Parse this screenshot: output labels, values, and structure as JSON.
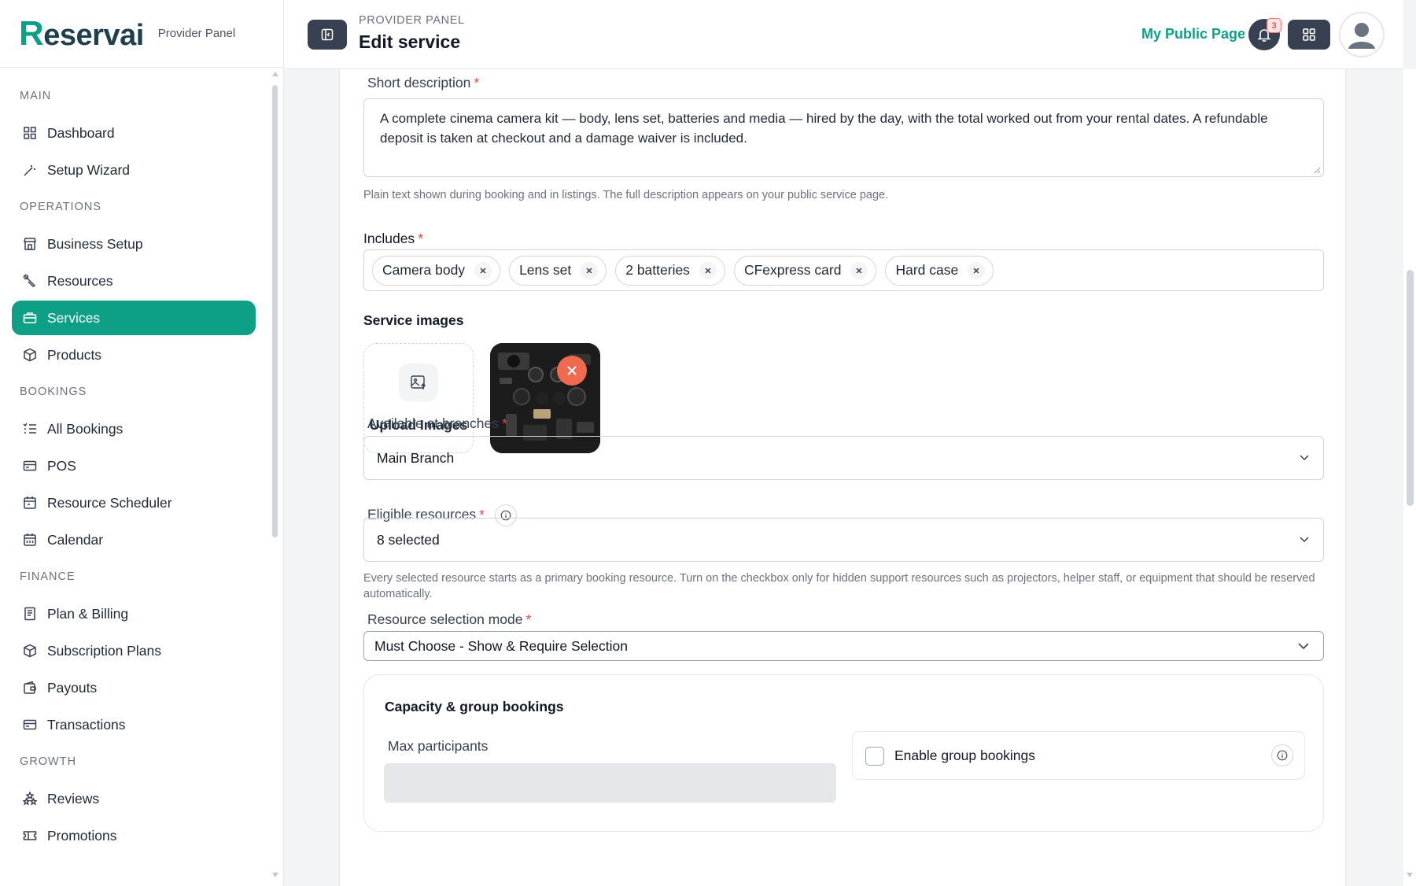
{
  "brand": {
    "logo_initial": "R",
    "logo_rest": "eservai",
    "subtitle": "Provider Panel"
  },
  "sidebar": {
    "sections": [
      {
        "title": "MAIN",
        "items": [
          {
            "label": "Dashboard",
            "icon": "grid-icon"
          },
          {
            "label": "Setup Wizard",
            "icon": "wand-icon"
          }
        ]
      },
      {
        "title": "OPERATIONS",
        "items": [
          {
            "label": "Business Setup",
            "icon": "store-icon"
          },
          {
            "label": "Resources",
            "icon": "tool-icon"
          },
          {
            "label": "Services",
            "icon": "briefcase-icon",
            "active": true
          },
          {
            "label": "Products",
            "icon": "box-icon"
          }
        ]
      },
      {
        "title": "BOOKINGS",
        "items": [
          {
            "label": "All Bookings",
            "icon": "list-icon"
          },
          {
            "label": "POS",
            "icon": "card-icon"
          },
          {
            "label": "Resource Scheduler",
            "icon": "calendar-icon"
          },
          {
            "label": "Calendar",
            "icon": "calendar-grid-icon"
          }
        ]
      },
      {
        "title": "FINANCE",
        "items": [
          {
            "label": "Plan & Billing",
            "icon": "receipt-icon"
          },
          {
            "label": "Subscription Plans",
            "icon": "box-icon"
          },
          {
            "label": "Payouts",
            "icon": "wallet-icon"
          },
          {
            "label": "Transactions",
            "icon": "card-icon"
          }
        ]
      },
      {
        "title": "GROWTH",
        "items": [
          {
            "label": "Reviews",
            "icon": "stars-icon"
          },
          {
            "label": "Promotions",
            "icon": "ticket-icon"
          }
        ]
      }
    ]
  },
  "header": {
    "breadcrumb": "PROVIDER PANEL",
    "title": "Edit service",
    "public_link": "My Public Page",
    "notification_count": "3"
  },
  "form": {
    "short_description": {
      "label": "Short description",
      "value": "A complete cinema camera kit — body, lens set, batteries and media — hired by the day, with the total worked out from your rental dates. A refundable deposit is taken at checkout and a damage waiver is included.",
      "hint": "Plain text shown during booking and in listings. The full description appears on your public service page."
    },
    "includes": {
      "label": "Includes",
      "tags": [
        "Camera body",
        "Lens set",
        "2 batteries",
        "CFexpress card",
        "Hard case"
      ]
    },
    "service_images": {
      "label": "Service images",
      "upload_label": "Upload Images"
    },
    "branches": {
      "label": "Available at branches",
      "value": "Main Branch"
    },
    "eligible_resources": {
      "label": "Eligible resources",
      "value": "8 selected",
      "hint": "Every selected resource starts as a primary booking resource. Turn on the checkbox only for hidden support resources such as projectors, helper staff, or equipment that should be reserved automatically."
    },
    "selection_mode": {
      "label": "Resource selection mode",
      "value": "Must Choose - Show & Require Selection"
    },
    "capacity": {
      "title": "Capacity & group bookings",
      "max_participants_label": "Max participants",
      "group_label": "Enable group bookings"
    }
  },
  "colors": {
    "accent": "#0e9f87",
    "dark_button": "#374151",
    "required": "#ef4444",
    "remove": "#ef6a4f"
  }
}
